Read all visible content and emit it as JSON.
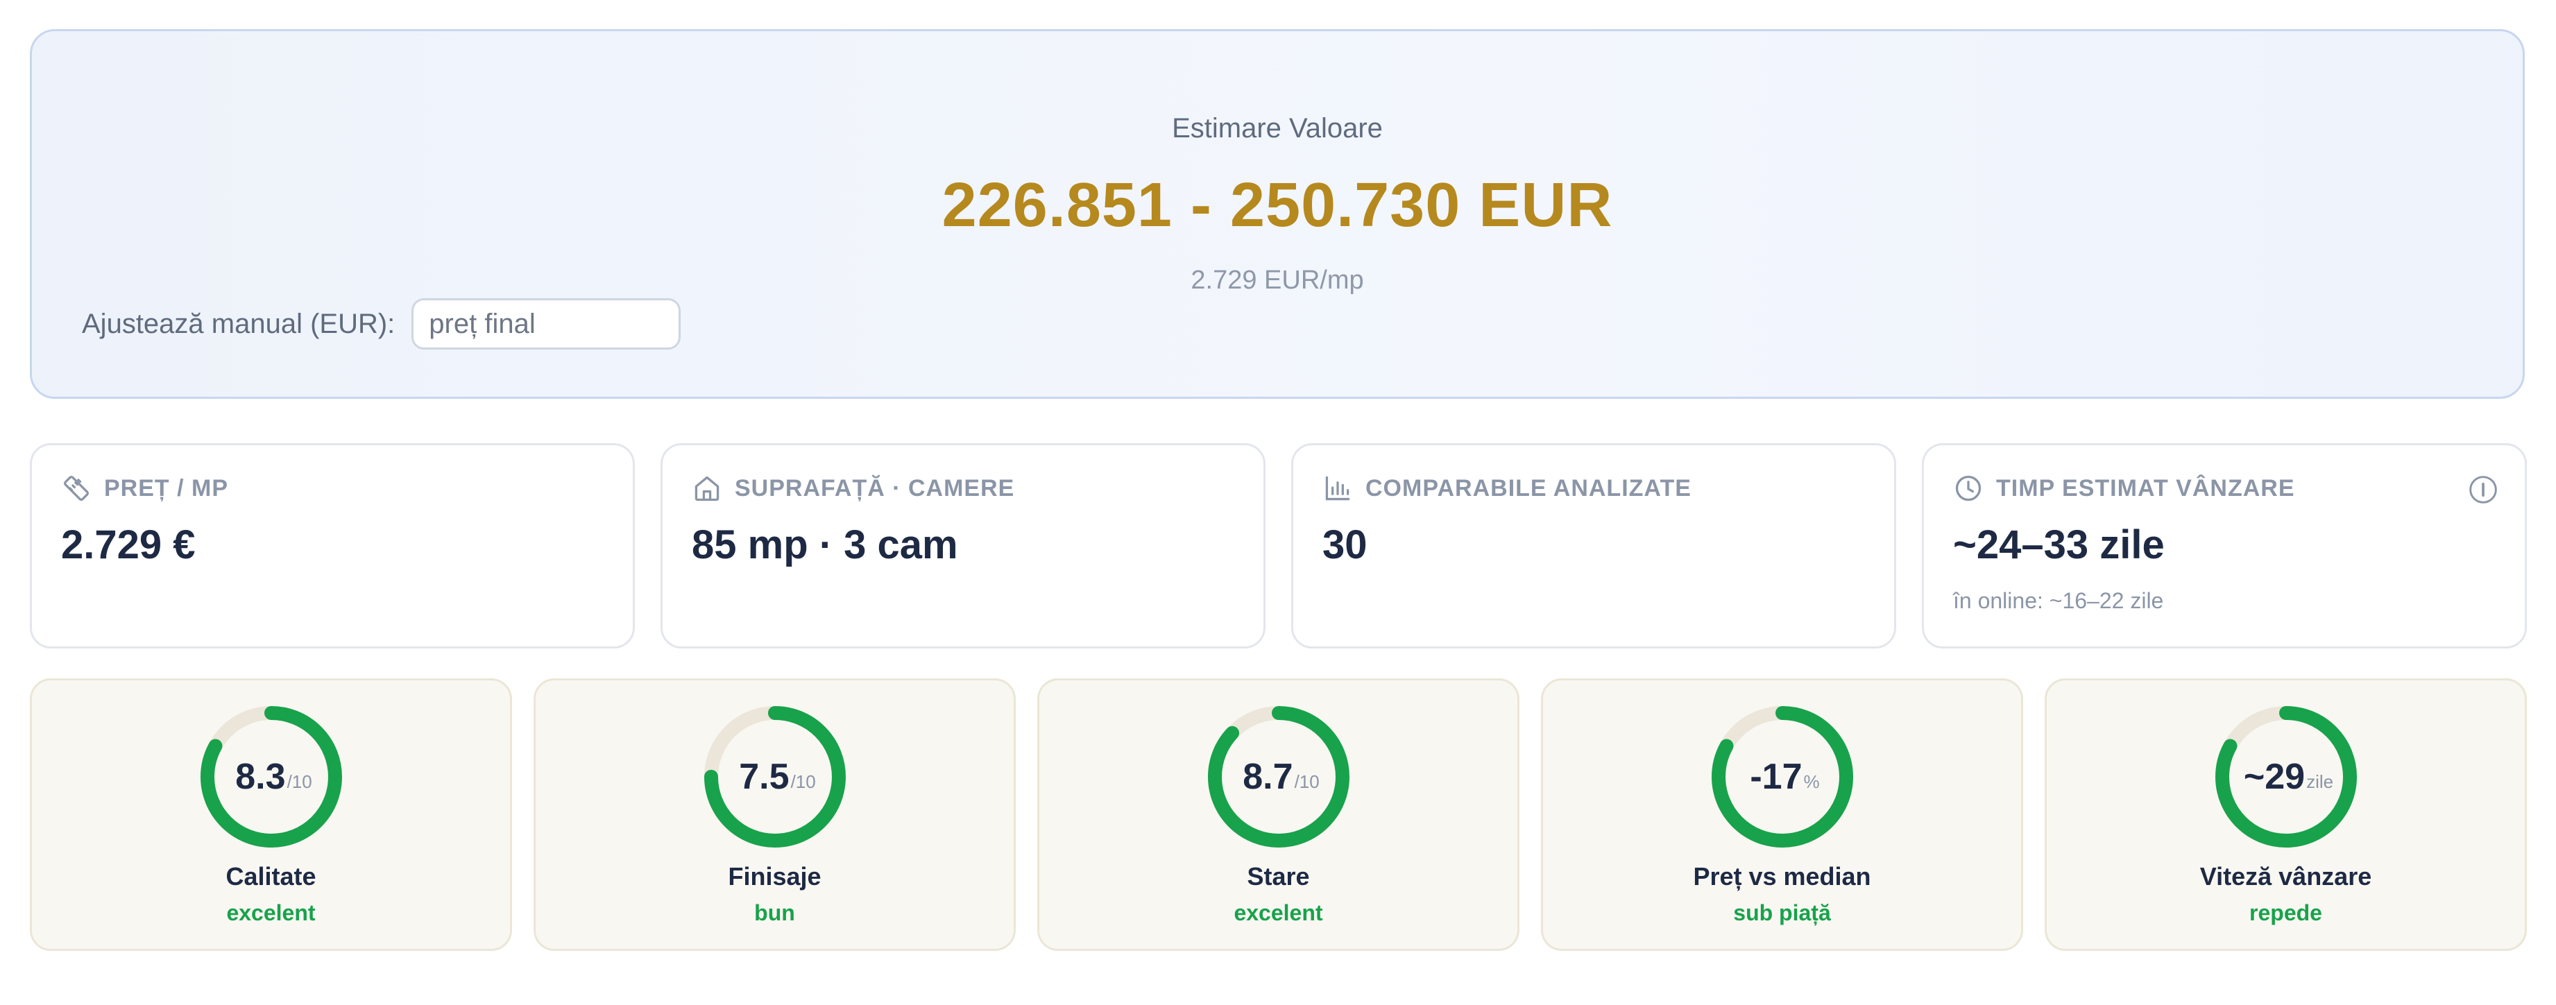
{
  "estimate": {
    "title": "Estimare Valoare",
    "range": "226.851 - 250.730 EUR",
    "per_sqm": "2.729 EUR/mp",
    "adjust_label": "Ajustează manual (EUR):",
    "adjust_placeholder": "preț final",
    "adjust_value": ""
  },
  "stats": [
    {
      "label": "PREȚ / MP",
      "icon": "ruler-icon",
      "value": "2.729 €",
      "note": ""
    },
    {
      "label": "SUPRAFAȚĂ · CAMERE",
      "icon": "home-icon",
      "value": "85 mp · 3 cam",
      "note": ""
    },
    {
      "label": "COMPARABILE ANALIZATE",
      "icon": "bar-chart-icon",
      "value": "30",
      "note": ""
    },
    {
      "label": "TIMP ESTIMAT VÂNZARE",
      "icon": "clock-icon",
      "value": "~24–33 zile",
      "note": "în online: ~16–22 zile",
      "info_icon": "info-icon"
    }
  ],
  "scores": [
    {
      "value": "8.3",
      "unit": "/10",
      "label": "Calitate",
      "verdict": "excelent",
      "fill": 0.83
    },
    {
      "value": "7.5",
      "unit": "/10",
      "label": "Finisaje",
      "verdict": "bun",
      "fill": 0.75
    },
    {
      "value": "8.7",
      "unit": "/10",
      "label": "Stare",
      "verdict": "excelent",
      "fill": 0.87
    },
    {
      "value": "-17",
      "unit": "%",
      "label": "Preț vs median",
      "verdict": "sub piață",
      "fill": 0.83
    },
    {
      "value": "~29",
      "unit": "zile",
      "label": "Viteză vânzare",
      "verdict": "repede",
      "fill": 0.83
    }
  ],
  "colors": {
    "accent_gold": "#b5891e",
    "gauge_green": "#18a24b",
    "gauge_track": "#ebe6d9",
    "text_dark": "#1e2a44",
    "text_muted": "#8b95a7"
  }
}
